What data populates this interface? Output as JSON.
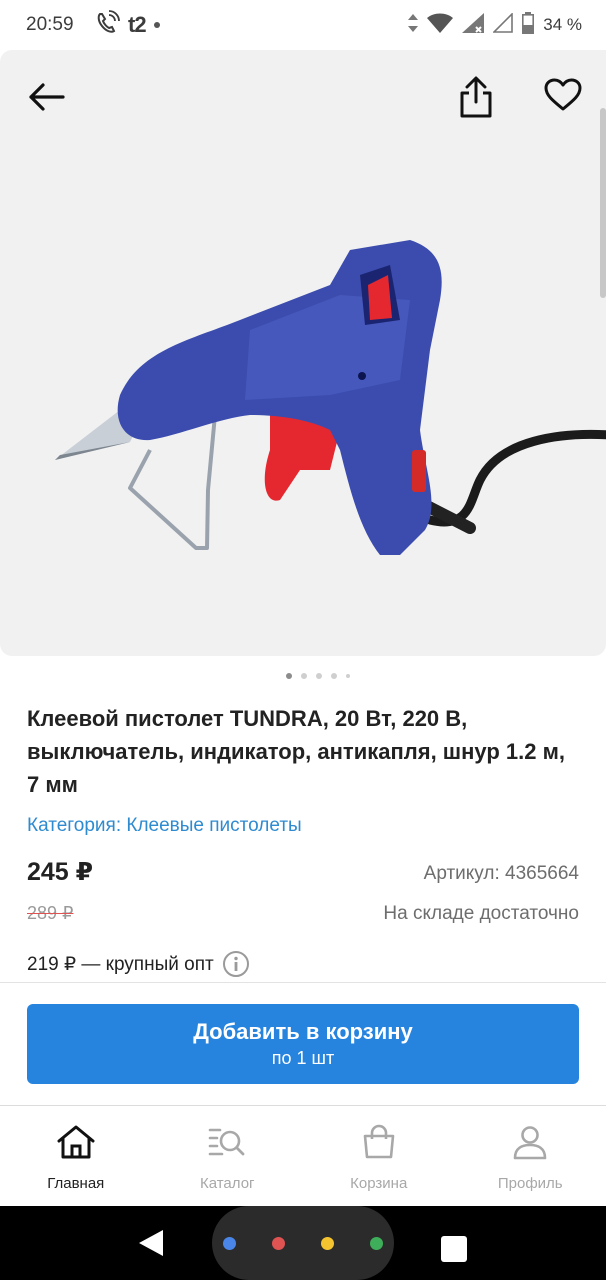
{
  "status_bar": {
    "time": "20:59",
    "carrier": "t2",
    "battery": "34 %"
  },
  "product": {
    "title": "Клеевой пистолет TUNDRA, 20 Вт, 220 В, выключатель, индикатор, антикапля, шнур 1.2 м, 7 мм",
    "category": "Категория: Клеевые пистолеты",
    "price": "245 ₽",
    "sku": "Артикул: 4365664",
    "old_price": "289 ₽",
    "stock": "На складе достаточно",
    "wholesale": "219 ₽ — крупный опт",
    "image_count": 5,
    "active_image": 1
  },
  "cart_button": {
    "label": "Добавить в корзину",
    "sublabel": "по 1 шт"
  },
  "bottom_nav": {
    "items": [
      {
        "label": "Главная",
        "icon": "home-icon",
        "active": true
      },
      {
        "label": "Каталог",
        "icon": "catalog-search-icon",
        "active": false
      },
      {
        "label": "Корзина",
        "icon": "shopping-bag-icon",
        "active": false
      },
      {
        "label": "Профиль",
        "icon": "profile-icon",
        "active": false
      }
    ]
  },
  "colors": {
    "accent": "#2684df",
    "link": "#2e8bd0",
    "gun_body": "#3b4cae",
    "gun_trigger": "#e5282f"
  }
}
